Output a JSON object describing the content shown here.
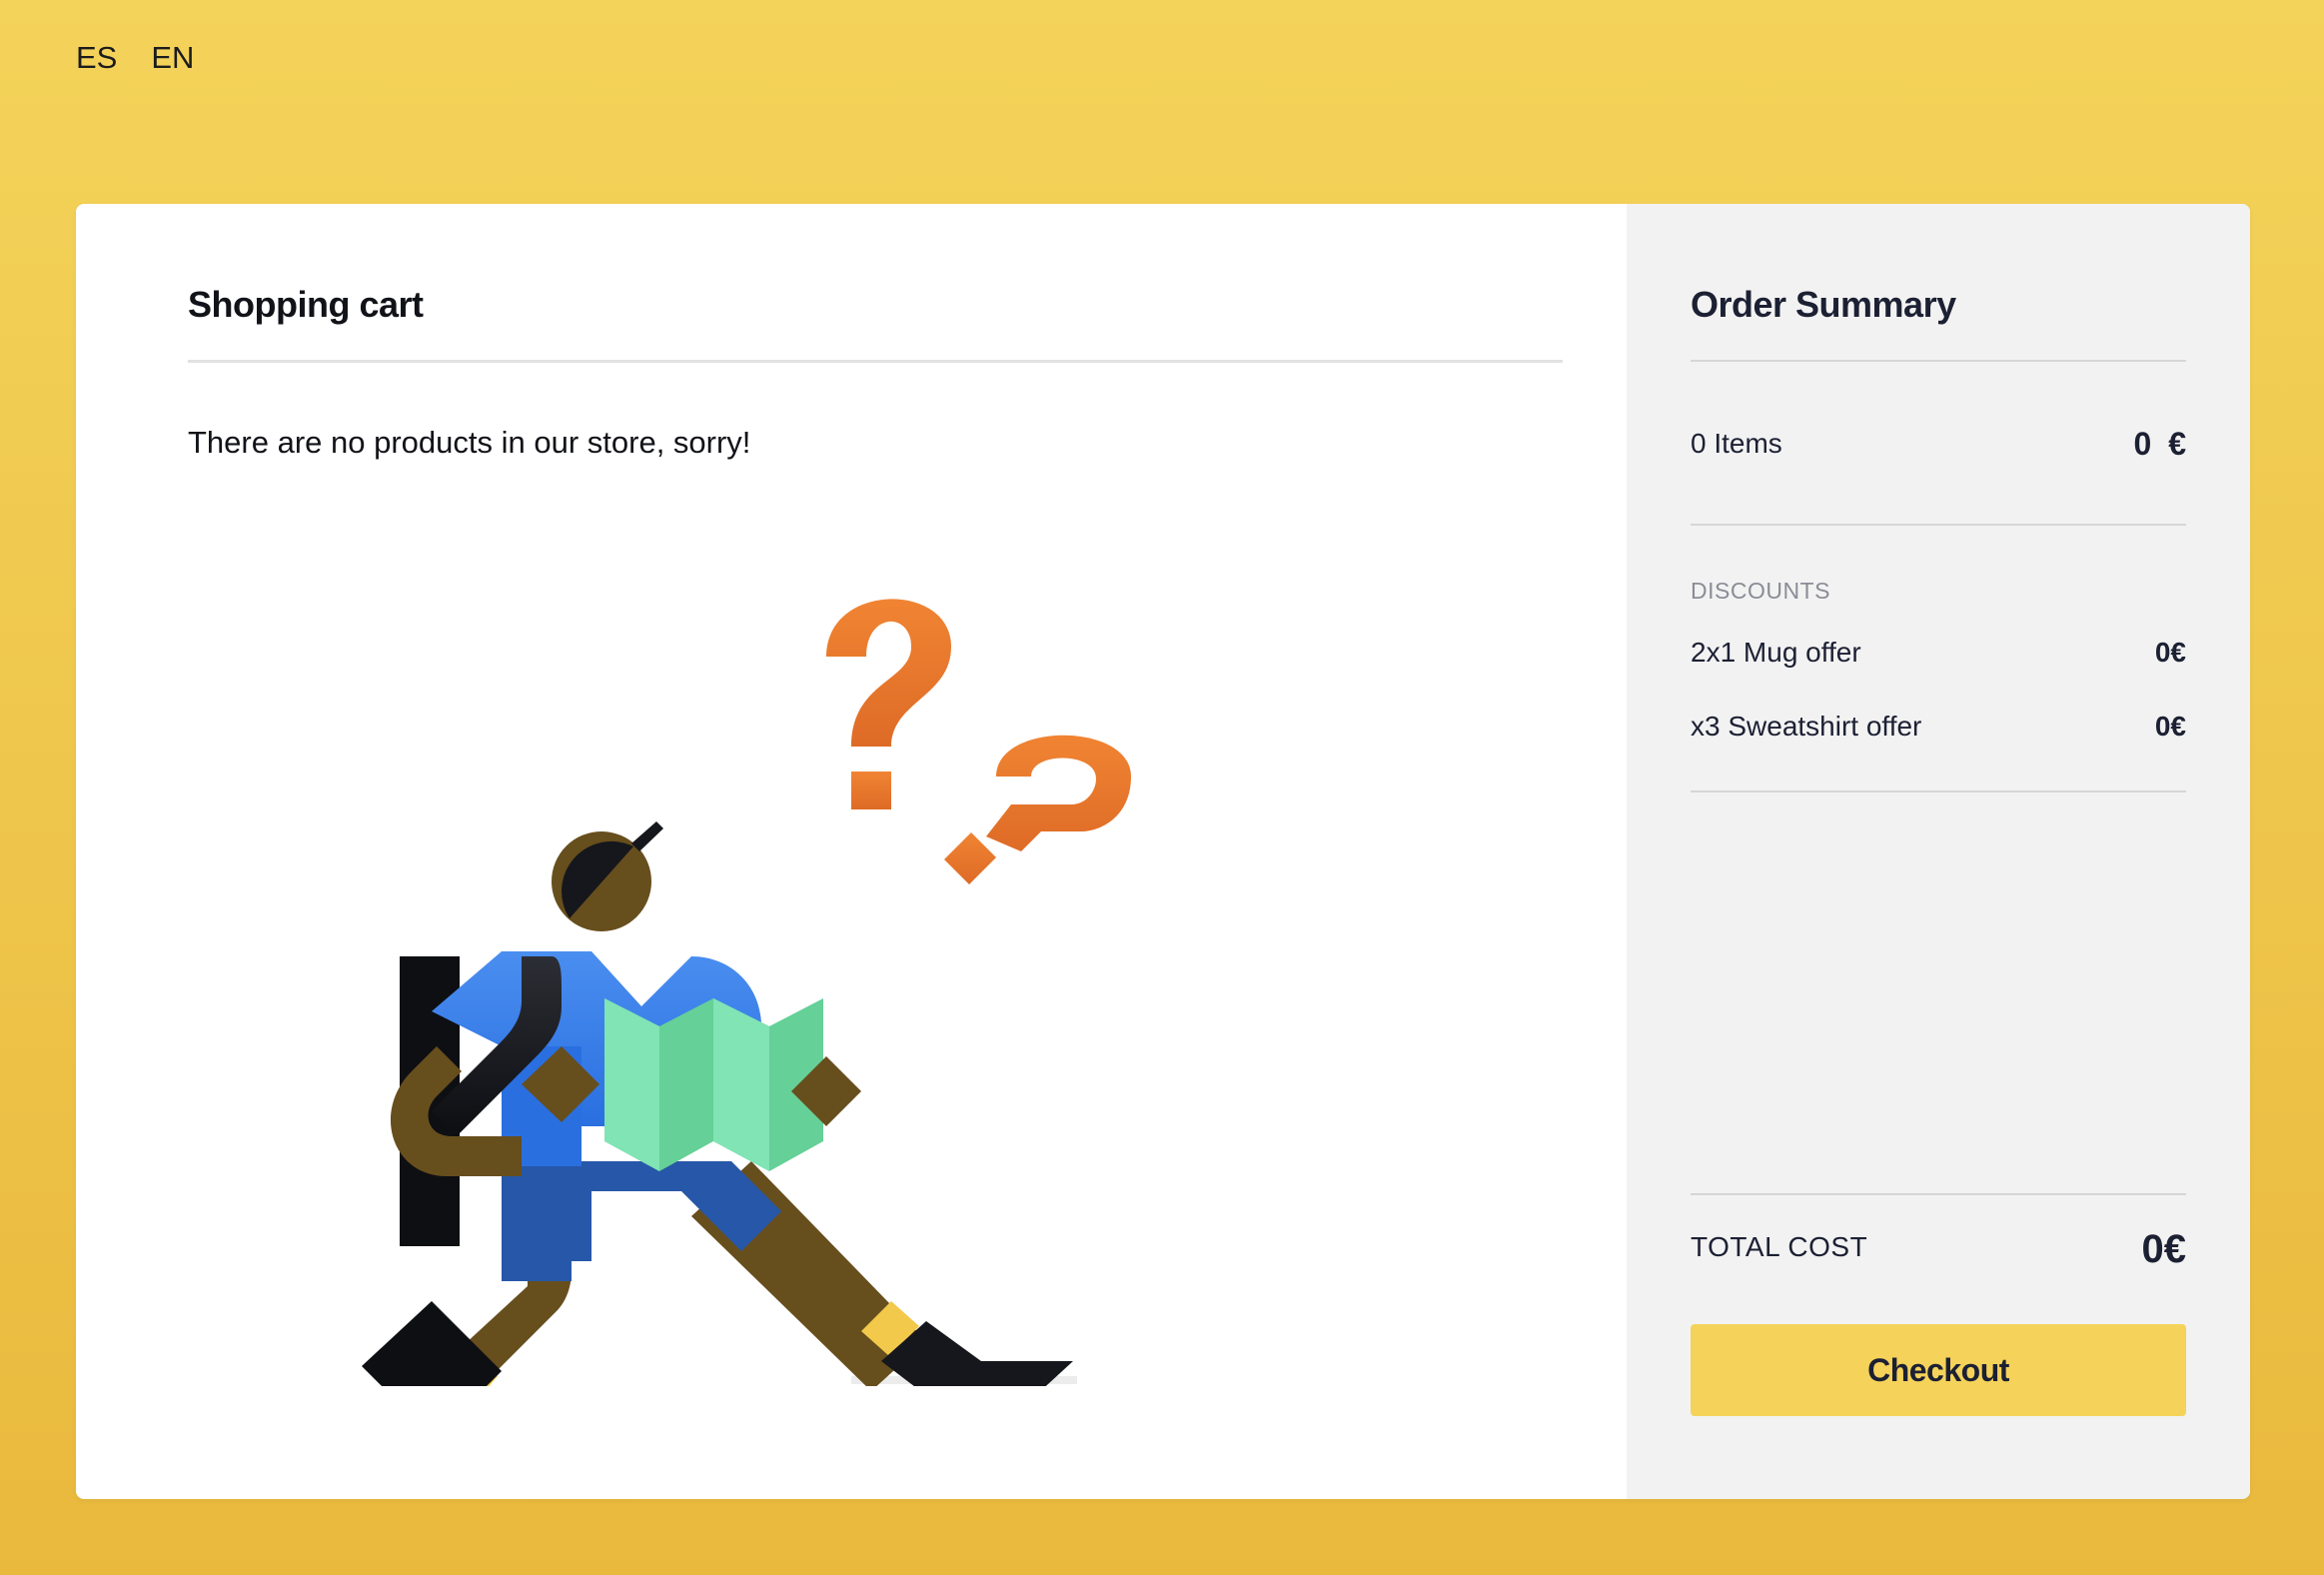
{
  "languages": [
    "ES",
    "EN"
  ],
  "cart": {
    "title": "Shopping cart",
    "empty_message": "There are no products in our store, sorry!"
  },
  "summary": {
    "title": "Order Summary",
    "items_label": "0 Items",
    "items_value": "0 €",
    "discounts_label": "DISCOUNTS",
    "discounts": [
      {
        "label": "2x1 Mug offer",
        "value": "0€"
      },
      {
        "label": "x3 Sweatshirt offer",
        "value": "0€"
      }
    ],
    "total_label": "TOTAL COST",
    "total_value": "0€",
    "checkout_label": "Checkout"
  },
  "colors": {
    "background_top": "#f4d35a",
    "background_bottom": "#e9b93d",
    "checkout_button": "#f5d25a",
    "summary_panel": "#f2f2f2"
  }
}
